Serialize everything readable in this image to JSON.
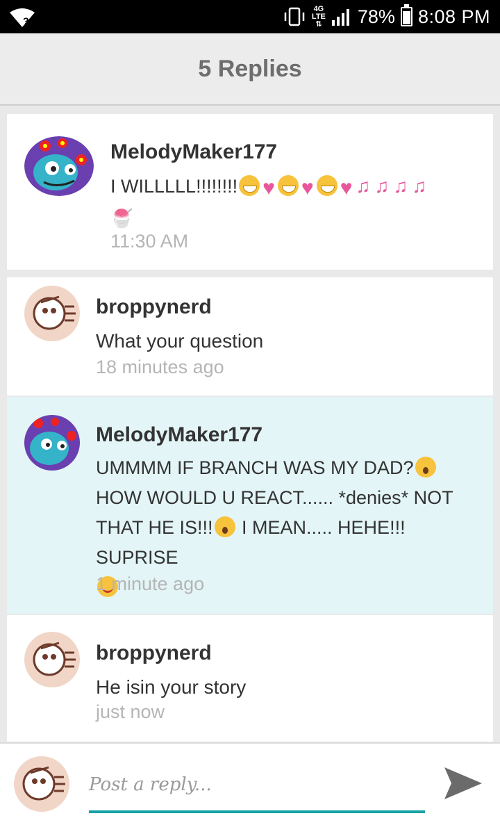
{
  "status_bar": {
    "network": "4G LTE",
    "battery": "78%",
    "battery_level": 0.78,
    "time": "8:08 PM"
  },
  "header": {
    "title": "5 Replies"
  },
  "replies": [
    {
      "username": "MelodyMaker177",
      "text": "I WILLLLL!!!!!!!!",
      "emojis_after": [
        "grinning-face",
        "sparkling-heart",
        "grinning-face",
        "sparkling-heart",
        "grinning-face",
        "sparkling-heart",
        "musical-notes",
        "musical-notes",
        "musical-notes",
        "musical-notes",
        "shaved-ice"
      ],
      "time": "11:30 AM"
    },
    {
      "username": "broppynerd",
      "text": "What your question",
      "time": "18 minutes ago"
    },
    {
      "username": "MelodyMaker177",
      "line1": "UMMMM IF BRANCH WAS MY DAD?",
      "line2": "HOW WOULD U REACT...... *denies* NOT",
      "line3a": "THAT HE IS!!!",
      "line3b": " I MEAN..... HEHE!!! SUPRISE",
      "time": "1 minute ago",
      "highlighted": true
    },
    {
      "username": "broppynerd",
      "text": "He isin your story",
      "time": "just now"
    }
  ],
  "reply_bar": {
    "placeholder": "Post a reply...",
    "accent": "#17a2a6"
  }
}
